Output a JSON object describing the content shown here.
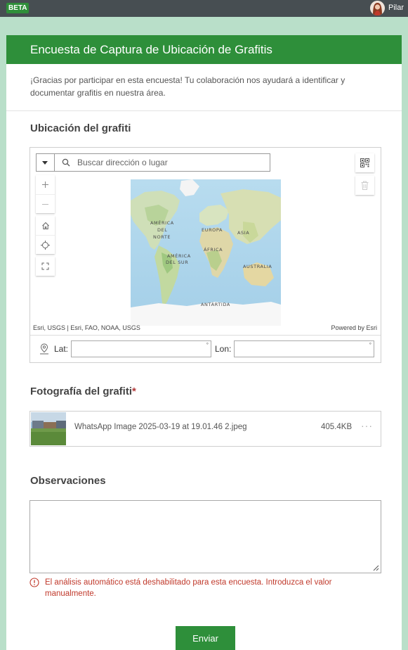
{
  "topbar": {
    "badge": "BETA",
    "user_name": "Pilar"
  },
  "survey": {
    "title": "Encuesta de Captura de Ubicación de Grafitis",
    "intro": "¡Gracias por participar en esta encuesta! Tu colaboración nos ayudará a identificar y documentar grafitis en nuestra área."
  },
  "location_question": {
    "title": "Ubicación del grafiti",
    "search_placeholder": "Buscar dirección o lugar",
    "map_labels": [
      "AMÉRICA DEL NORTE",
      "EUROPA",
      "ASIA",
      "ÁFRICA",
      "AMÉRICA DEL SUR",
      "AUSTRALIA",
      "ANTÁRTIDA"
    ],
    "map_labels_split": {
      "na1": "AMÉRICA",
      "na2": "DEL",
      "na3": "NORTE",
      "eu": "EUROPA",
      "as": "ASIA",
      "af": "ÁFRICA",
      "sa1": "AMÉRICA",
      "sa2": "DEL SUR",
      "au": "AUSTRALIA",
      "an": "ANTÁRTIDA"
    },
    "attribution": "Esri, USGS | Esri, FAO, NOAA, USGS",
    "powered_by": "Powered by Esri",
    "lat_label": "Lat:",
    "lon_label": "Lon:",
    "lat_value": "",
    "lon_value": "",
    "unit": "°"
  },
  "photo_question": {
    "title": "Fotografía del grafiti",
    "required_mark": "*",
    "file": {
      "name": "WhatsApp Image 2025-03-19 at 19.01.46 2.jpeg",
      "size": "405.4KB",
      "more": "···"
    }
  },
  "observations_question": {
    "title": "Observaciones",
    "value": "",
    "error": "El análisis automático está deshabilitado para esta encuesta. Introduzca el valor manualmente."
  },
  "submit_label": "Enviar",
  "colors": {
    "brand_green": "#2e8f3a",
    "background": "#b9dfc9",
    "error_red": "#c0392b",
    "topbar": "#474e52"
  }
}
